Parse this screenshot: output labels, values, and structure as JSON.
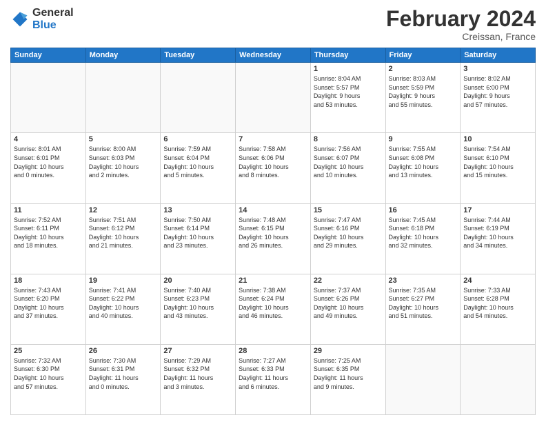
{
  "logo": {
    "line1": "General",
    "line2": "Blue"
  },
  "title": "February 2024",
  "subtitle": "Creissan, France",
  "weekdays": [
    "Sunday",
    "Monday",
    "Tuesday",
    "Wednesday",
    "Thursday",
    "Friday",
    "Saturday"
  ],
  "weeks": [
    [
      {
        "day": "",
        "info": ""
      },
      {
        "day": "",
        "info": ""
      },
      {
        "day": "",
        "info": ""
      },
      {
        "day": "",
        "info": ""
      },
      {
        "day": "1",
        "info": "Sunrise: 8:04 AM\nSunset: 5:57 PM\nDaylight: 9 hours\nand 53 minutes."
      },
      {
        "day": "2",
        "info": "Sunrise: 8:03 AM\nSunset: 5:59 PM\nDaylight: 9 hours\nand 55 minutes."
      },
      {
        "day": "3",
        "info": "Sunrise: 8:02 AM\nSunset: 6:00 PM\nDaylight: 9 hours\nand 57 minutes."
      }
    ],
    [
      {
        "day": "4",
        "info": "Sunrise: 8:01 AM\nSunset: 6:01 PM\nDaylight: 10 hours\nand 0 minutes."
      },
      {
        "day": "5",
        "info": "Sunrise: 8:00 AM\nSunset: 6:03 PM\nDaylight: 10 hours\nand 2 minutes."
      },
      {
        "day": "6",
        "info": "Sunrise: 7:59 AM\nSunset: 6:04 PM\nDaylight: 10 hours\nand 5 minutes."
      },
      {
        "day": "7",
        "info": "Sunrise: 7:58 AM\nSunset: 6:06 PM\nDaylight: 10 hours\nand 8 minutes."
      },
      {
        "day": "8",
        "info": "Sunrise: 7:56 AM\nSunset: 6:07 PM\nDaylight: 10 hours\nand 10 minutes."
      },
      {
        "day": "9",
        "info": "Sunrise: 7:55 AM\nSunset: 6:08 PM\nDaylight: 10 hours\nand 13 minutes."
      },
      {
        "day": "10",
        "info": "Sunrise: 7:54 AM\nSunset: 6:10 PM\nDaylight: 10 hours\nand 15 minutes."
      }
    ],
    [
      {
        "day": "11",
        "info": "Sunrise: 7:52 AM\nSunset: 6:11 PM\nDaylight: 10 hours\nand 18 minutes."
      },
      {
        "day": "12",
        "info": "Sunrise: 7:51 AM\nSunset: 6:12 PM\nDaylight: 10 hours\nand 21 minutes."
      },
      {
        "day": "13",
        "info": "Sunrise: 7:50 AM\nSunset: 6:14 PM\nDaylight: 10 hours\nand 23 minutes."
      },
      {
        "day": "14",
        "info": "Sunrise: 7:48 AM\nSunset: 6:15 PM\nDaylight: 10 hours\nand 26 minutes."
      },
      {
        "day": "15",
        "info": "Sunrise: 7:47 AM\nSunset: 6:16 PM\nDaylight: 10 hours\nand 29 minutes."
      },
      {
        "day": "16",
        "info": "Sunrise: 7:45 AM\nSunset: 6:18 PM\nDaylight: 10 hours\nand 32 minutes."
      },
      {
        "day": "17",
        "info": "Sunrise: 7:44 AM\nSunset: 6:19 PM\nDaylight: 10 hours\nand 34 minutes."
      }
    ],
    [
      {
        "day": "18",
        "info": "Sunrise: 7:43 AM\nSunset: 6:20 PM\nDaylight: 10 hours\nand 37 minutes."
      },
      {
        "day": "19",
        "info": "Sunrise: 7:41 AM\nSunset: 6:22 PM\nDaylight: 10 hours\nand 40 minutes."
      },
      {
        "day": "20",
        "info": "Sunrise: 7:40 AM\nSunset: 6:23 PM\nDaylight: 10 hours\nand 43 minutes."
      },
      {
        "day": "21",
        "info": "Sunrise: 7:38 AM\nSunset: 6:24 PM\nDaylight: 10 hours\nand 46 minutes."
      },
      {
        "day": "22",
        "info": "Sunrise: 7:37 AM\nSunset: 6:26 PM\nDaylight: 10 hours\nand 49 minutes."
      },
      {
        "day": "23",
        "info": "Sunrise: 7:35 AM\nSunset: 6:27 PM\nDaylight: 10 hours\nand 51 minutes."
      },
      {
        "day": "24",
        "info": "Sunrise: 7:33 AM\nSunset: 6:28 PM\nDaylight: 10 hours\nand 54 minutes."
      }
    ],
    [
      {
        "day": "25",
        "info": "Sunrise: 7:32 AM\nSunset: 6:30 PM\nDaylight: 10 hours\nand 57 minutes."
      },
      {
        "day": "26",
        "info": "Sunrise: 7:30 AM\nSunset: 6:31 PM\nDaylight: 11 hours\nand 0 minutes."
      },
      {
        "day": "27",
        "info": "Sunrise: 7:29 AM\nSunset: 6:32 PM\nDaylight: 11 hours\nand 3 minutes."
      },
      {
        "day": "28",
        "info": "Sunrise: 7:27 AM\nSunset: 6:33 PM\nDaylight: 11 hours\nand 6 minutes."
      },
      {
        "day": "29",
        "info": "Sunrise: 7:25 AM\nSunset: 6:35 PM\nDaylight: 11 hours\nand 9 minutes."
      },
      {
        "day": "",
        "info": ""
      },
      {
        "day": "",
        "info": ""
      }
    ]
  ]
}
